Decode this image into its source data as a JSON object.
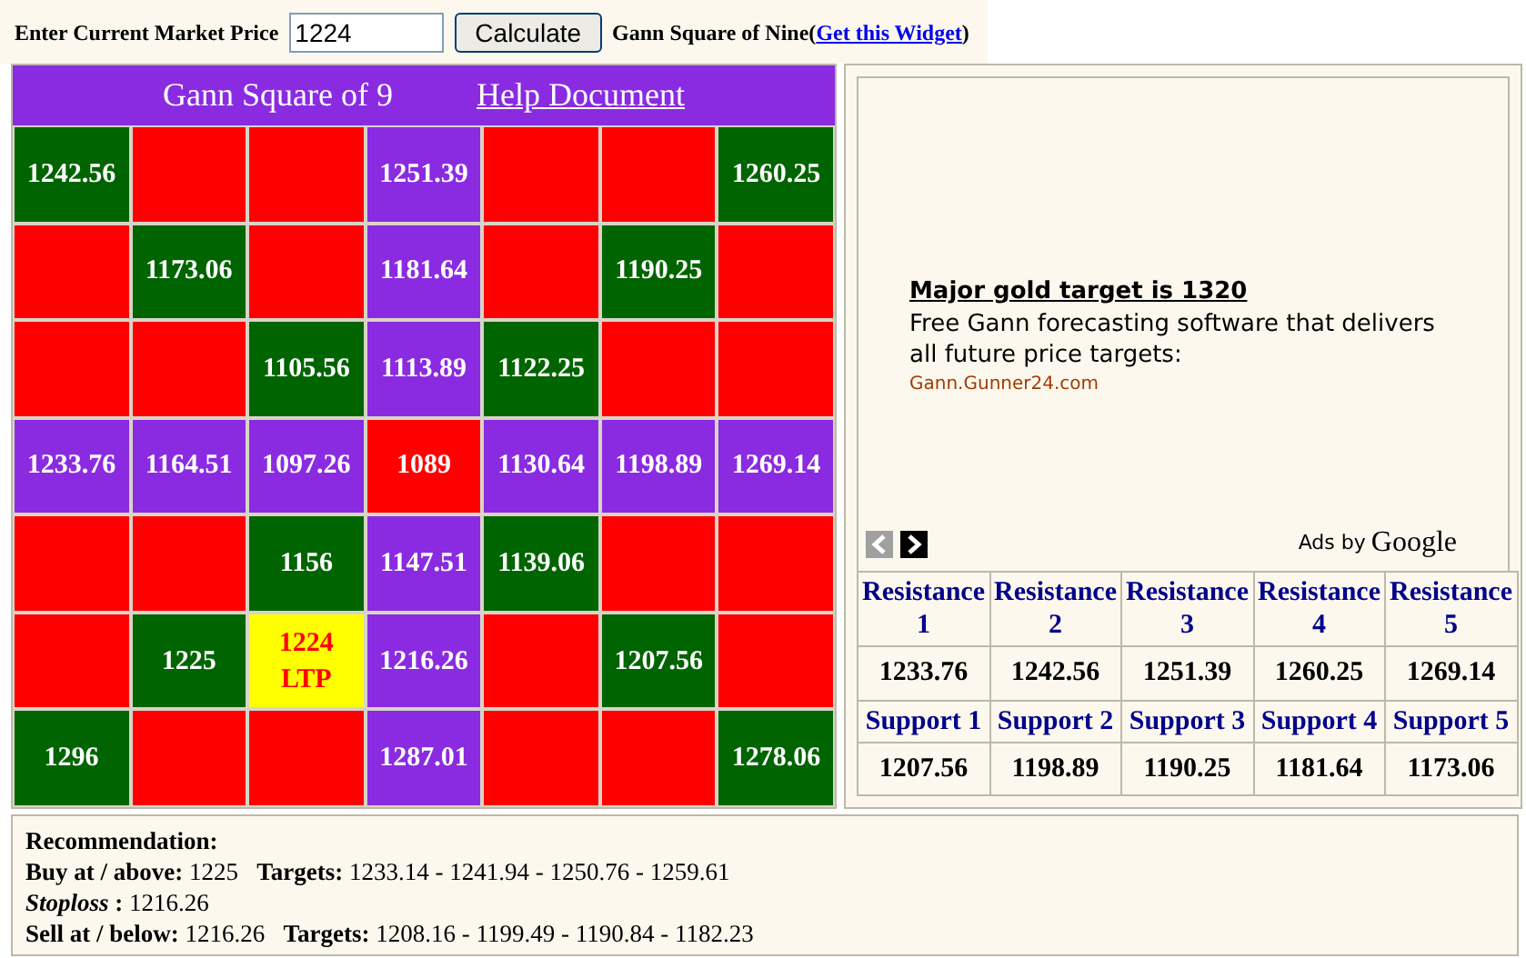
{
  "toolbar": {
    "label": "Enter Current Market Price",
    "price": "1224",
    "button": "Calculate",
    "widget_title": "Gann Square of Nine(",
    "widget_link": "Get this Widget",
    "widget_close": ")"
  },
  "square": {
    "title": "Gann Square of 9",
    "help_link": "Help Document",
    "rows": [
      [
        {
          "color": "#006400",
          "text": "1242.56"
        },
        {
          "color": "#ff0000"
        },
        {
          "color": "#ff0000"
        },
        {
          "color": "#8a2be2",
          "text": "1251.39"
        },
        {
          "color": "#ff0000"
        },
        {
          "color": "#ff0000"
        },
        {
          "color": "#006400",
          "text": "1260.25"
        }
      ],
      [
        {
          "color": "#ff0000"
        },
        {
          "color": "#006400",
          "text": "1173.06"
        },
        {
          "color": "#ff0000"
        },
        {
          "color": "#8a2be2",
          "text": "1181.64"
        },
        {
          "color": "#ff0000"
        },
        {
          "color": "#006400",
          "text": "1190.25"
        },
        {
          "color": "#ff0000"
        }
      ],
      [
        {
          "color": "#ff0000"
        },
        {
          "color": "#ff0000"
        },
        {
          "color": "#006400",
          "text": "1105.56"
        },
        {
          "color": "#8a2be2",
          "text": "1113.89"
        },
        {
          "color": "#006400",
          "text": "1122.25"
        },
        {
          "color": "#ff0000"
        },
        {
          "color": "#ff0000"
        }
      ],
      [
        {
          "color": "#8a2be2",
          "text": "1233.76"
        },
        {
          "color": "#8a2be2",
          "text": "1164.51"
        },
        {
          "color": "#8a2be2",
          "text": "1097.26"
        },
        {
          "color": "#ff0000",
          "text": "1089"
        },
        {
          "color": "#8a2be2",
          "text": "1130.64"
        },
        {
          "color": "#8a2be2",
          "text": "1198.89"
        },
        {
          "color": "#8a2be2",
          "text": "1269.14"
        }
      ],
      [
        {
          "color": "#ff0000"
        },
        {
          "color": "#ff0000"
        },
        {
          "color": "#006400",
          "text": "1156"
        },
        {
          "color": "#8a2be2",
          "text": "1147.51"
        },
        {
          "color": "#006400",
          "text": "1139.06"
        },
        {
          "color": "#ff0000"
        },
        {
          "color": "#ff0000"
        }
      ],
      [
        {
          "color": "#ff0000"
        },
        {
          "color": "#006400",
          "text": "1225"
        },
        {
          "color": "#ffff00",
          "text": "1224",
          "note": "LTP"
        },
        {
          "color": "#8a2be2",
          "text": "1216.26"
        },
        {
          "color": "#ff0000"
        },
        {
          "color": "#006400",
          "text": "1207.56"
        },
        {
          "color": "#ff0000"
        }
      ],
      [
        {
          "color": "#006400",
          "text": "1296"
        },
        {
          "color": "#ff0000"
        },
        {
          "color": "#ff0000"
        },
        {
          "color": "#8a2be2",
          "text": "1287.01"
        },
        {
          "color": "#ff0000"
        },
        {
          "color": "#ff0000"
        },
        {
          "color": "#006400",
          "text": "1278.06"
        }
      ]
    ]
  },
  "ad": {
    "headline": "Major gold target is 1320",
    "body": "Free Gann forecasting software that delivers all future price targets:",
    "url": "Gann.Gunner24.com",
    "ads_by": "Ads by",
    "brand": "Google"
  },
  "levels": {
    "resistance_labels": [
      "Resistance 1",
      "Resistance 2",
      "Resistance 3",
      "Resistance 4",
      "Resistance 5"
    ],
    "resistance_values": [
      "1233.76",
      "1242.56",
      "1251.39",
      "1260.25",
      "1269.14"
    ],
    "support_labels": [
      "Support 1",
      "Support 2",
      "Support 3",
      "Support 4",
      "Support 5"
    ],
    "support_values": [
      "1207.56",
      "1198.89",
      "1190.25",
      "1181.64",
      "1173.06"
    ]
  },
  "recommendation": {
    "title": "Recommendation:",
    "lines": [
      "**Buy at / above:** 1225   **Targets:** 1233.14 - 1241.94 - 1250.76 - 1259.61",
      "***Stoploss* :** 1216.26",
      "**Sell at / below:** 1216.26   **Targets:** 1208.16 - 1199.49 - 1190.84 - 1182.23"
    ]
  }
}
